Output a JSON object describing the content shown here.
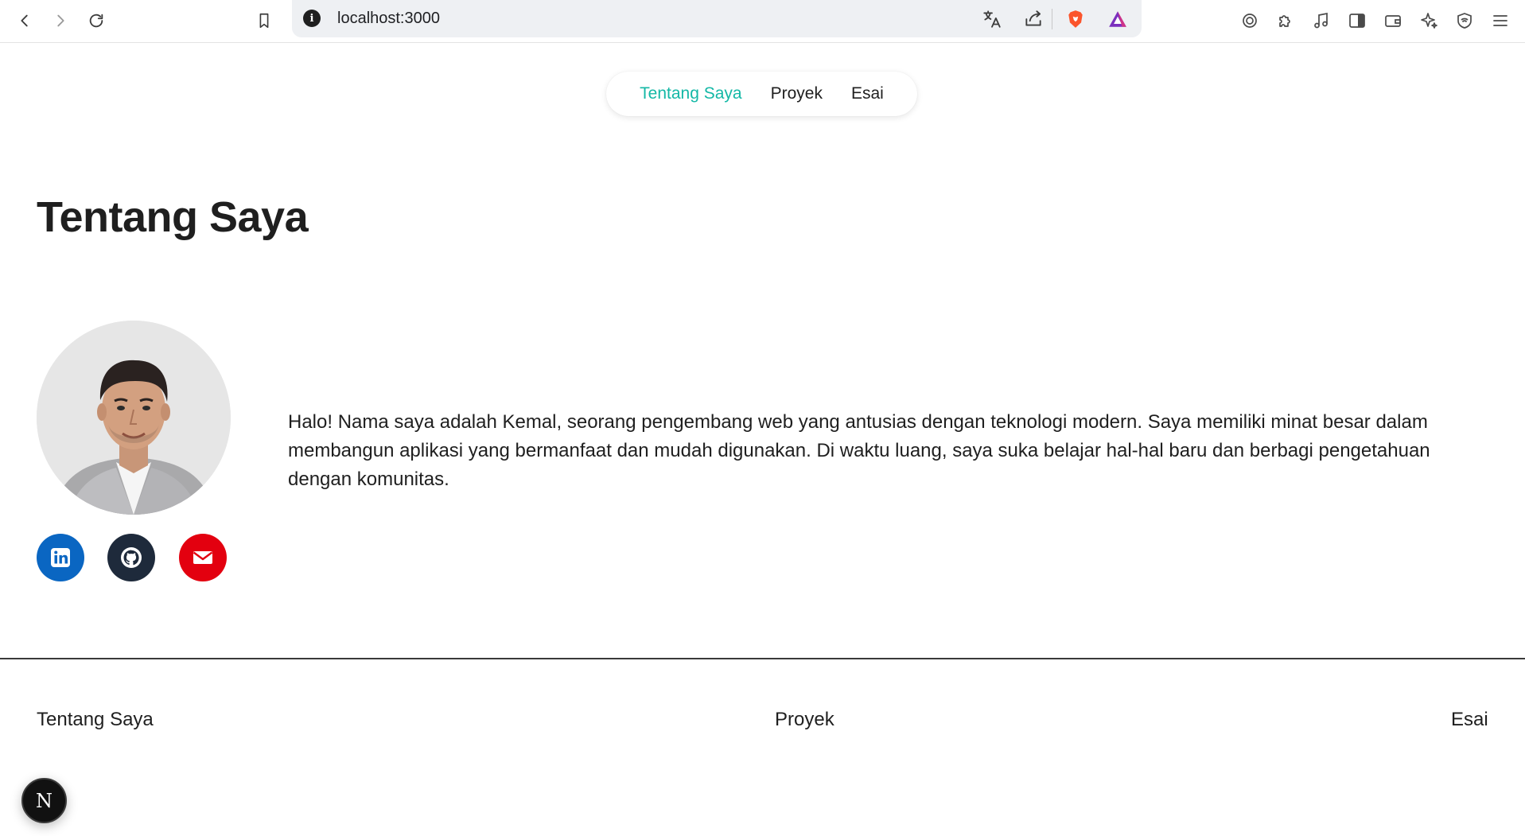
{
  "browser": {
    "url": "localhost:3000",
    "info_glyph": "i"
  },
  "nav": {
    "items": [
      {
        "label": "Tentang Saya",
        "active": true
      },
      {
        "label": "Proyek",
        "active": false
      },
      {
        "label": "Esai",
        "active": false
      }
    ]
  },
  "main": {
    "title": "Tentang Saya",
    "bio": "Halo! Nama saya adalah Kemal, seorang pengembang web yang antusias dengan teknologi modern. Saya memiliki minat besar dalam membangun aplikasi yang bermanfaat dan mudah digunakan. Di waktu luang, saya suka belajar hal-hal baru dan berbagi pengetahuan dengan komunitas.",
    "social": [
      {
        "icon": "linkedin-icon",
        "color": "#0a66c2"
      },
      {
        "icon": "github-icon",
        "color": "#1e2a3b"
      },
      {
        "icon": "mail-icon",
        "color": "#e3000f"
      }
    ]
  },
  "footer": {
    "links": [
      "Tentang Saya",
      "Proyek",
      "Esai"
    ]
  },
  "dev_badge": {
    "label": "N"
  },
  "colors": {
    "accent": "#14b8a6",
    "text": "#1f1f1f"
  }
}
